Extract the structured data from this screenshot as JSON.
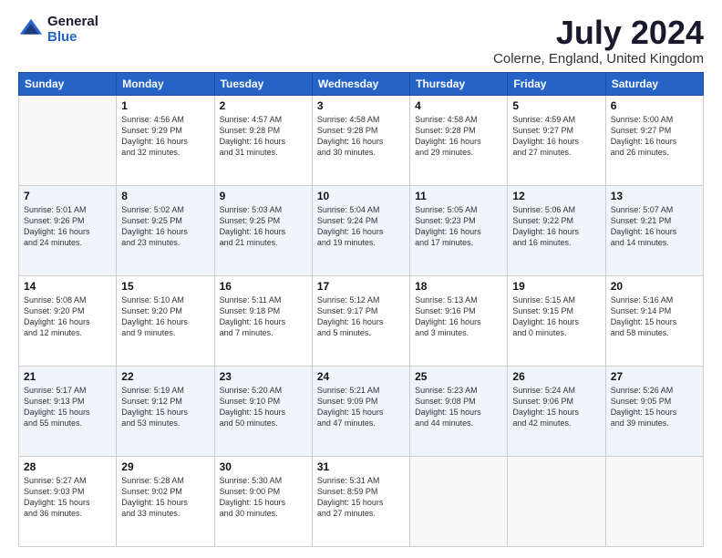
{
  "header": {
    "logo_general": "General",
    "logo_blue": "Blue",
    "title": "July 2024",
    "subtitle": "Colerne, England, United Kingdom"
  },
  "days_of_week": [
    "Sunday",
    "Monday",
    "Tuesday",
    "Wednesday",
    "Thursday",
    "Friday",
    "Saturday"
  ],
  "weeks": [
    [
      {
        "num": "",
        "sunrise": "",
        "sunset": "",
        "daylight": ""
      },
      {
        "num": "1",
        "sunrise": "Sunrise: 4:56 AM",
        "sunset": "Sunset: 9:29 PM",
        "daylight": "Daylight: 16 hours and 32 minutes."
      },
      {
        "num": "2",
        "sunrise": "Sunrise: 4:57 AM",
        "sunset": "Sunset: 9:28 PM",
        "daylight": "Daylight: 16 hours and 31 minutes."
      },
      {
        "num": "3",
        "sunrise": "Sunrise: 4:58 AM",
        "sunset": "Sunset: 9:28 PM",
        "daylight": "Daylight: 16 hours and 30 minutes."
      },
      {
        "num": "4",
        "sunrise": "Sunrise: 4:58 AM",
        "sunset": "Sunset: 9:28 PM",
        "daylight": "Daylight: 16 hours and 29 minutes."
      },
      {
        "num": "5",
        "sunrise": "Sunrise: 4:59 AM",
        "sunset": "Sunset: 9:27 PM",
        "daylight": "Daylight: 16 hours and 27 minutes."
      },
      {
        "num": "6",
        "sunrise": "Sunrise: 5:00 AM",
        "sunset": "Sunset: 9:27 PM",
        "daylight": "Daylight: 16 hours and 26 minutes."
      }
    ],
    [
      {
        "num": "7",
        "sunrise": "Sunrise: 5:01 AM",
        "sunset": "Sunset: 9:26 PM",
        "daylight": "Daylight: 16 hours and 24 minutes."
      },
      {
        "num": "8",
        "sunrise": "Sunrise: 5:02 AM",
        "sunset": "Sunset: 9:25 PM",
        "daylight": "Daylight: 16 hours and 23 minutes."
      },
      {
        "num": "9",
        "sunrise": "Sunrise: 5:03 AM",
        "sunset": "Sunset: 9:25 PM",
        "daylight": "Daylight: 16 hours and 21 minutes."
      },
      {
        "num": "10",
        "sunrise": "Sunrise: 5:04 AM",
        "sunset": "Sunset: 9:24 PM",
        "daylight": "Daylight: 16 hours and 19 minutes."
      },
      {
        "num": "11",
        "sunrise": "Sunrise: 5:05 AM",
        "sunset": "Sunset: 9:23 PM",
        "daylight": "Daylight: 16 hours and 17 minutes."
      },
      {
        "num": "12",
        "sunrise": "Sunrise: 5:06 AM",
        "sunset": "Sunset: 9:22 PM",
        "daylight": "Daylight: 16 hours and 16 minutes."
      },
      {
        "num": "13",
        "sunrise": "Sunrise: 5:07 AM",
        "sunset": "Sunset: 9:21 PM",
        "daylight": "Daylight: 16 hours and 14 minutes."
      }
    ],
    [
      {
        "num": "14",
        "sunrise": "Sunrise: 5:08 AM",
        "sunset": "Sunset: 9:20 PM",
        "daylight": "Daylight: 16 hours and 12 minutes."
      },
      {
        "num": "15",
        "sunrise": "Sunrise: 5:10 AM",
        "sunset": "Sunset: 9:20 PM",
        "daylight": "Daylight: 16 hours and 9 minutes."
      },
      {
        "num": "16",
        "sunrise": "Sunrise: 5:11 AM",
        "sunset": "Sunset: 9:18 PM",
        "daylight": "Daylight: 16 hours and 7 minutes."
      },
      {
        "num": "17",
        "sunrise": "Sunrise: 5:12 AM",
        "sunset": "Sunset: 9:17 PM",
        "daylight": "Daylight: 16 hours and 5 minutes."
      },
      {
        "num": "18",
        "sunrise": "Sunrise: 5:13 AM",
        "sunset": "Sunset: 9:16 PM",
        "daylight": "Daylight: 16 hours and 3 minutes."
      },
      {
        "num": "19",
        "sunrise": "Sunrise: 5:15 AM",
        "sunset": "Sunset: 9:15 PM",
        "daylight": "Daylight: 16 hours and 0 minutes."
      },
      {
        "num": "20",
        "sunrise": "Sunrise: 5:16 AM",
        "sunset": "Sunset: 9:14 PM",
        "daylight": "Daylight: 15 hours and 58 minutes."
      }
    ],
    [
      {
        "num": "21",
        "sunrise": "Sunrise: 5:17 AM",
        "sunset": "Sunset: 9:13 PM",
        "daylight": "Daylight: 15 hours and 55 minutes."
      },
      {
        "num": "22",
        "sunrise": "Sunrise: 5:19 AM",
        "sunset": "Sunset: 9:12 PM",
        "daylight": "Daylight: 15 hours and 53 minutes."
      },
      {
        "num": "23",
        "sunrise": "Sunrise: 5:20 AM",
        "sunset": "Sunset: 9:10 PM",
        "daylight": "Daylight: 15 hours and 50 minutes."
      },
      {
        "num": "24",
        "sunrise": "Sunrise: 5:21 AM",
        "sunset": "Sunset: 9:09 PM",
        "daylight": "Daylight: 15 hours and 47 minutes."
      },
      {
        "num": "25",
        "sunrise": "Sunrise: 5:23 AM",
        "sunset": "Sunset: 9:08 PM",
        "daylight": "Daylight: 15 hours and 44 minutes."
      },
      {
        "num": "26",
        "sunrise": "Sunrise: 5:24 AM",
        "sunset": "Sunset: 9:06 PM",
        "daylight": "Daylight: 15 hours and 42 minutes."
      },
      {
        "num": "27",
        "sunrise": "Sunrise: 5:26 AM",
        "sunset": "Sunset: 9:05 PM",
        "daylight": "Daylight: 15 hours and 39 minutes."
      }
    ],
    [
      {
        "num": "28",
        "sunrise": "Sunrise: 5:27 AM",
        "sunset": "Sunset: 9:03 PM",
        "daylight": "Daylight: 15 hours and 36 minutes."
      },
      {
        "num": "29",
        "sunrise": "Sunrise: 5:28 AM",
        "sunset": "Sunset: 9:02 PM",
        "daylight": "Daylight: 15 hours and 33 minutes."
      },
      {
        "num": "30",
        "sunrise": "Sunrise: 5:30 AM",
        "sunset": "Sunset: 9:00 PM",
        "daylight": "Daylight: 15 hours and 30 minutes."
      },
      {
        "num": "31",
        "sunrise": "Sunrise: 5:31 AM",
        "sunset": "Sunset: 8:59 PM",
        "daylight": "Daylight: 15 hours and 27 minutes."
      },
      {
        "num": "",
        "sunrise": "",
        "sunset": "",
        "daylight": ""
      },
      {
        "num": "",
        "sunrise": "",
        "sunset": "",
        "daylight": ""
      },
      {
        "num": "",
        "sunrise": "",
        "sunset": "",
        "daylight": ""
      }
    ]
  ]
}
